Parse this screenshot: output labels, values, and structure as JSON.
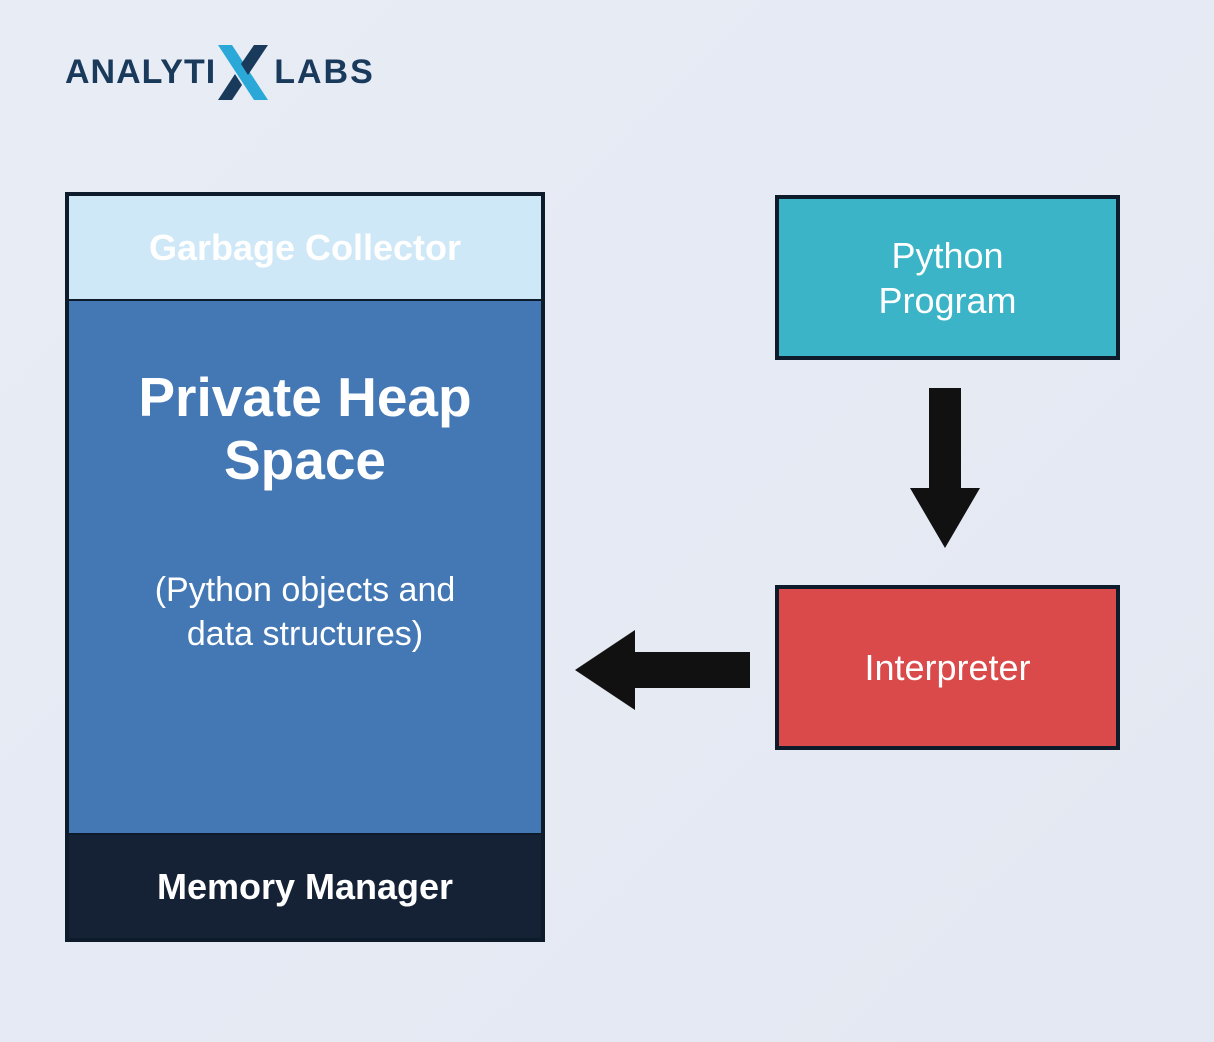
{
  "logo": {
    "part1": "ANALYTI",
    "part2": "LABS"
  },
  "heap": {
    "garbage_collector": "Garbage Collector",
    "title_line1": "Private Heap",
    "title_line2": "Space",
    "subtitle_line1": "(Python objects and",
    "subtitle_line2": "data structures)",
    "memory_manager": "Memory Manager"
  },
  "boxes": {
    "python_line1": "Python",
    "python_line2": "Program",
    "interpreter": "Interpreter"
  },
  "colors": {
    "gc_bg": "#cfe8f7",
    "heap_bg": "#4378b5",
    "mm_bg": "#152235",
    "python_bg": "#3cb4c7",
    "interpreter_bg": "#db4a4a",
    "border": "#0d1b2a",
    "arrow": "#111111"
  }
}
